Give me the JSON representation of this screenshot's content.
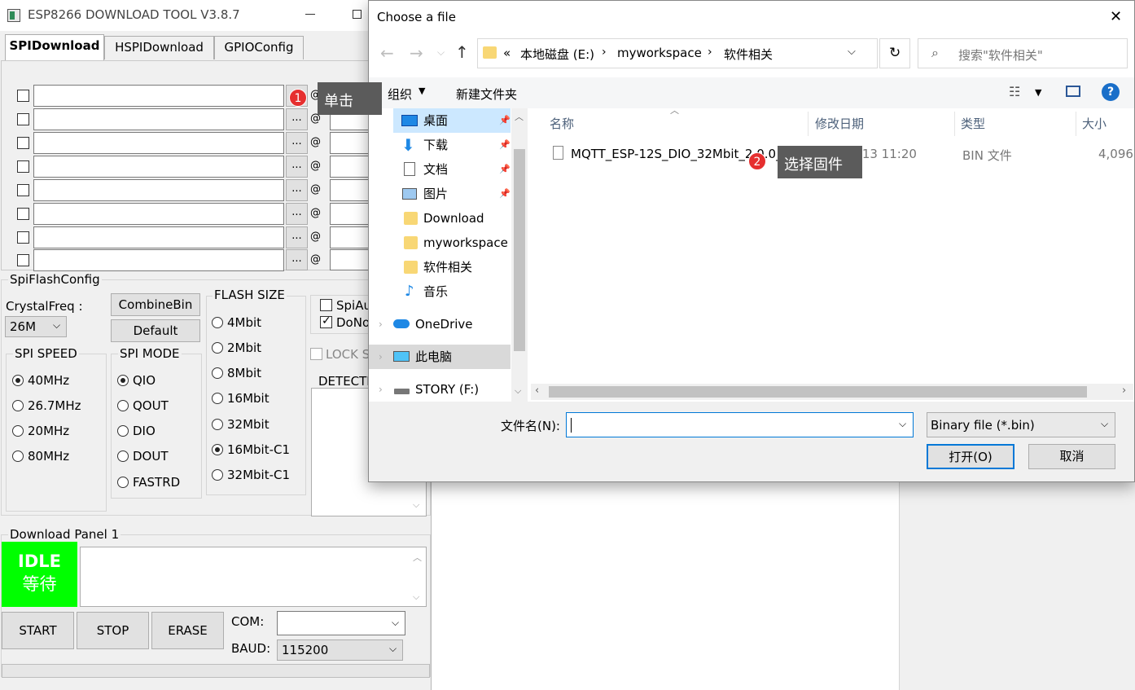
{
  "esp": {
    "title": "ESP8266 DOWNLOAD TOOL V3.8.7",
    "tabs": [
      "SPIDownload",
      "HSPIDownload",
      "GPIOConfig"
    ],
    "browse_label": "...",
    "at_label": "@",
    "spiflash_config": "SpiFlashConfig",
    "crystal_label": "CrystalFreq :",
    "crystal_value": "26M",
    "combine_bin": "CombineBin",
    "default_btn": "Default",
    "flash_size_title": "FLASH SIZE",
    "flash_sizes": [
      "4Mbit",
      "2Mbit",
      "8Mbit",
      "16Mbit",
      "32Mbit",
      "16Mbit-C1",
      "32Mbit-C1"
    ],
    "flash_selected": "16Mbit-C1",
    "spi_speed_title": "SPI SPEED",
    "spi_speeds": [
      "40MHz",
      "26.7MHz",
      "20MHz",
      "80MHz"
    ],
    "spi_speed_selected": "40MHz",
    "spi_mode_title": "SPI MODE",
    "spi_modes": [
      "QIO",
      "QOUT",
      "DIO",
      "DOUT",
      "FASTRD"
    ],
    "spi_mode_selected": "QIO",
    "spiauto": "SpiAu",
    "donot": "DoNo",
    "lock": "LOCK S",
    "detected": "DETECTE",
    "download_panel": "Download Panel 1",
    "idle": "IDLE",
    "idle_cn": "等待",
    "start": "START",
    "stop": "STOP",
    "erase": "ERASE",
    "com_label": "COM:",
    "baud_label": "BAUD:",
    "baud_value": "115200"
  },
  "dialog": {
    "title": "Choose a file",
    "close": "✕",
    "breadcrumb": [
      "«",
      "本地磁盘 (E:)",
      "myworkspace",
      "软件相关"
    ],
    "search_placeholder": "搜索\"软件相关\"",
    "organize": "组织",
    "new_folder": "新建文件夹",
    "sidebar": [
      {
        "label": "桌面",
        "icon": "desktop-icon",
        "pinned": true
      },
      {
        "label": "下载",
        "icon": "download-icon",
        "pinned": true
      },
      {
        "label": "文档",
        "icon": "document-icon",
        "pinned": true
      },
      {
        "label": "图片",
        "icon": "picture-icon",
        "pinned": true
      },
      {
        "label": "Download",
        "icon": "folder-icon",
        "pinned": false
      },
      {
        "label": "myworkspace",
        "icon": "folder-icon",
        "pinned": false
      },
      {
        "label": "软件相关",
        "icon": "folder-icon",
        "pinned": false
      },
      {
        "label": "音乐",
        "icon": "music-icon",
        "pinned": false
      },
      {
        "label": "OneDrive",
        "icon": "cloud-icon",
        "pinned": false
      },
      {
        "label": "此电脑",
        "icon": "computer-icon",
        "pinned": false
      },
      {
        "label": "STORY (F:)",
        "icon": "drive-icon",
        "pinned": false
      }
    ],
    "columns": [
      "名称",
      "修改日期",
      "类型",
      "大小"
    ],
    "file": {
      "name": "MQTT_ESP-12S_DIO_32Mbit_2.0.0_20",
      "date": "2020/3/13 11:20",
      "type": "BIN 文件",
      "size": "4,096"
    },
    "filename_label": "文件名(N):",
    "filter": "Binary file (*.bin)",
    "open": "打开(O)",
    "cancel": "取消"
  },
  "callouts": [
    {
      "num": "1",
      "text": "单击"
    },
    {
      "num": "2",
      "text": "选择固件"
    }
  ]
}
